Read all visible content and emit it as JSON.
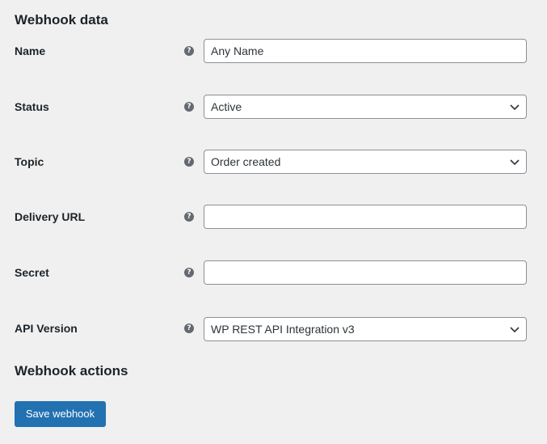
{
  "webhook_data": {
    "title": "Webhook data",
    "fields": {
      "name": {
        "label": "Name",
        "value": "Any Name",
        "placeholder": ""
      },
      "status": {
        "label": "Status",
        "selected": "Active"
      },
      "topic": {
        "label": "Topic",
        "selected": "Order created"
      },
      "delivery_url": {
        "label": "Delivery URL",
        "value": "",
        "placeholder": ""
      },
      "secret": {
        "label": "Secret",
        "value": "",
        "placeholder": ""
      },
      "api_version": {
        "label": "API Version",
        "selected": "WP REST API Integration v3"
      }
    }
  },
  "webhook_actions": {
    "title": "Webhook actions",
    "save_label": "Save webhook"
  },
  "icons": {
    "help": "question-circle-icon",
    "dropdown": "chevron-down-icon"
  },
  "colors": {
    "background": "#f0f0f1",
    "primary_button": "#2271b1",
    "field_border": "#8c8f94",
    "help_icon": "#646970"
  }
}
